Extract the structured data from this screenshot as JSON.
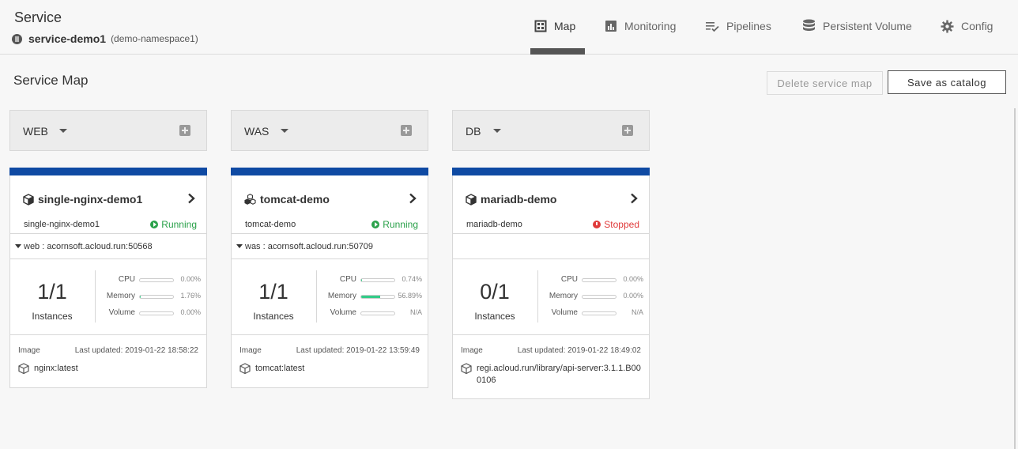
{
  "header": {
    "title": "Service",
    "service_name": "service-demo1",
    "namespace": "(demo-namespace1)"
  },
  "nav": {
    "tabs": [
      {
        "label": "Map",
        "icon": "map-icon",
        "active": true
      },
      {
        "label": "Monitoring",
        "icon": "chart-icon",
        "active": false
      },
      {
        "label": "Pipelines",
        "icon": "pipelines-icon",
        "active": false
      },
      {
        "label": "Persistent Volume",
        "icon": "database-icon",
        "active": false
      },
      {
        "label": "Config",
        "icon": "gear-icon",
        "active": false
      }
    ]
  },
  "service_map": {
    "title": "Service Map",
    "delete_label": "Delete service map",
    "save_label": "Save as catalog"
  },
  "colors": {
    "card_bar": "#0f4aa3",
    "running": "#2aa14a",
    "stopped": "#e03a3a",
    "memory_fill": "#33cc88"
  },
  "columns": [
    {
      "label": "WEB",
      "card": {
        "name": "single-nginx-demo1",
        "icon": "cube-icon",
        "sub": "single-nginx-demo1",
        "status": "Running",
        "endpoint": "web : acornsoft.acloud.run:50568",
        "instances": "1/1",
        "instances_label": "Instances",
        "metrics": [
          {
            "label": "CPU",
            "value": "0.00%",
            "fraction": 0.0
          },
          {
            "label": "Memory",
            "value": "1.76%",
            "fraction": 0.0176
          },
          {
            "label": "Volume",
            "value": "0.00%",
            "fraction": 0.0
          }
        ],
        "image_label": "Image",
        "last_updated": "Last updated: 2019-01-22 18:58:22",
        "image": "nginx:latest"
      }
    },
    {
      "label": "WAS",
      "card": {
        "name": "tomcat-demo",
        "icon": "cubes-icon",
        "sub": "tomcat-demo",
        "status": "Running",
        "endpoint": "was : acornsoft.acloud.run:50709",
        "instances": "1/1",
        "instances_label": "Instances",
        "metrics": [
          {
            "label": "CPU",
            "value": "0.74%",
            "fraction": 0.0074
          },
          {
            "label": "Memory",
            "value": "56.89%",
            "fraction": 0.5689
          },
          {
            "label": "Volume",
            "value": "N/A",
            "fraction": 0.0
          }
        ],
        "image_label": "Image",
        "last_updated": "Last updated: 2019-01-22 13:59:49",
        "image": "tomcat:latest"
      }
    },
    {
      "label": "DB",
      "card": {
        "name": "mariadb-demo",
        "icon": "cube-icon",
        "sub": "mariadb-demo",
        "status": "Stopped",
        "endpoint": "",
        "instances": "0/1",
        "instances_label": "Instances",
        "metrics": [
          {
            "label": "CPU",
            "value": "0.00%",
            "fraction": 0.0
          },
          {
            "label": "Memory",
            "value": "0.00%",
            "fraction": 0.0
          },
          {
            "label": "Volume",
            "value": "N/A",
            "fraction": 0.0
          }
        ],
        "image_label": "Image",
        "last_updated": "Last updated: 2019-01-22 18:49:02",
        "image": "regi.acloud.run/library/api-server:3.1.1.B000106"
      }
    }
  ]
}
